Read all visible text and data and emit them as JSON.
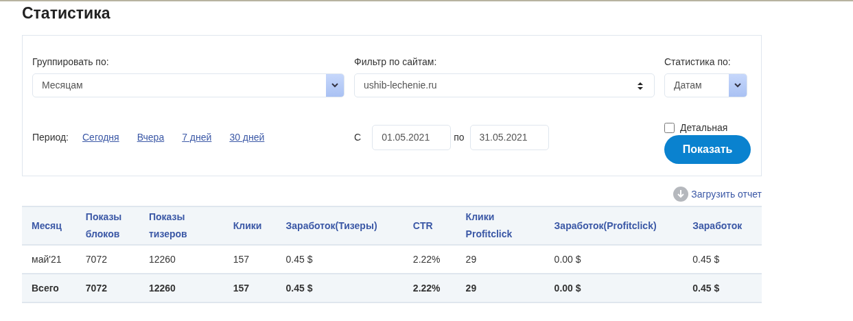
{
  "title": "Статистика",
  "filters": {
    "group_by": {
      "label": "Группировать по:",
      "value": "Месяцам"
    },
    "site_filter": {
      "label": "Фильтр по сайтам:",
      "value": "ushib-lechenie.ru"
    },
    "stats_by": {
      "label": "Статистика по:",
      "value": "Датам"
    },
    "period": {
      "label": "Период:",
      "links": [
        "Сегодня",
        "Вчера",
        "7 дней",
        "30 дней"
      ]
    },
    "date_range": {
      "from_label": "С",
      "from": "01.05.2021",
      "to_label": "по",
      "to": "31.05.2021"
    },
    "detailed": {
      "label": "Детальная",
      "checked": false
    },
    "show_button": "Показать"
  },
  "download_link": "Загрузить отчет",
  "table": {
    "columns": [
      "Месяц",
      "Показы блоков",
      "Показы тизеров",
      "Клики",
      "Заработок(Тизеры)",
      "CTR",
      "Клики Profitclick",
      "Заработок(Profitclick)",
      "Заработок"
    ],
    "rows": [
      {
        "kind": "data",
        "cells": [
          "май'21",
          "7072",
          "12260",
          "157",
          "0.45 $",
          "2.22%",
          "29",
          "0.00 $",
          "0.45 $"
        ]
      },
      {
        "kind": "total",
        "cells": [
          "Всего",
          "7072",
          "12260",
          "157",
          "0.45 $",
          "2.22%",
          "29",
          "0.00 $",
          "0.45 $"
        ]
      }
    ]
  }
}
